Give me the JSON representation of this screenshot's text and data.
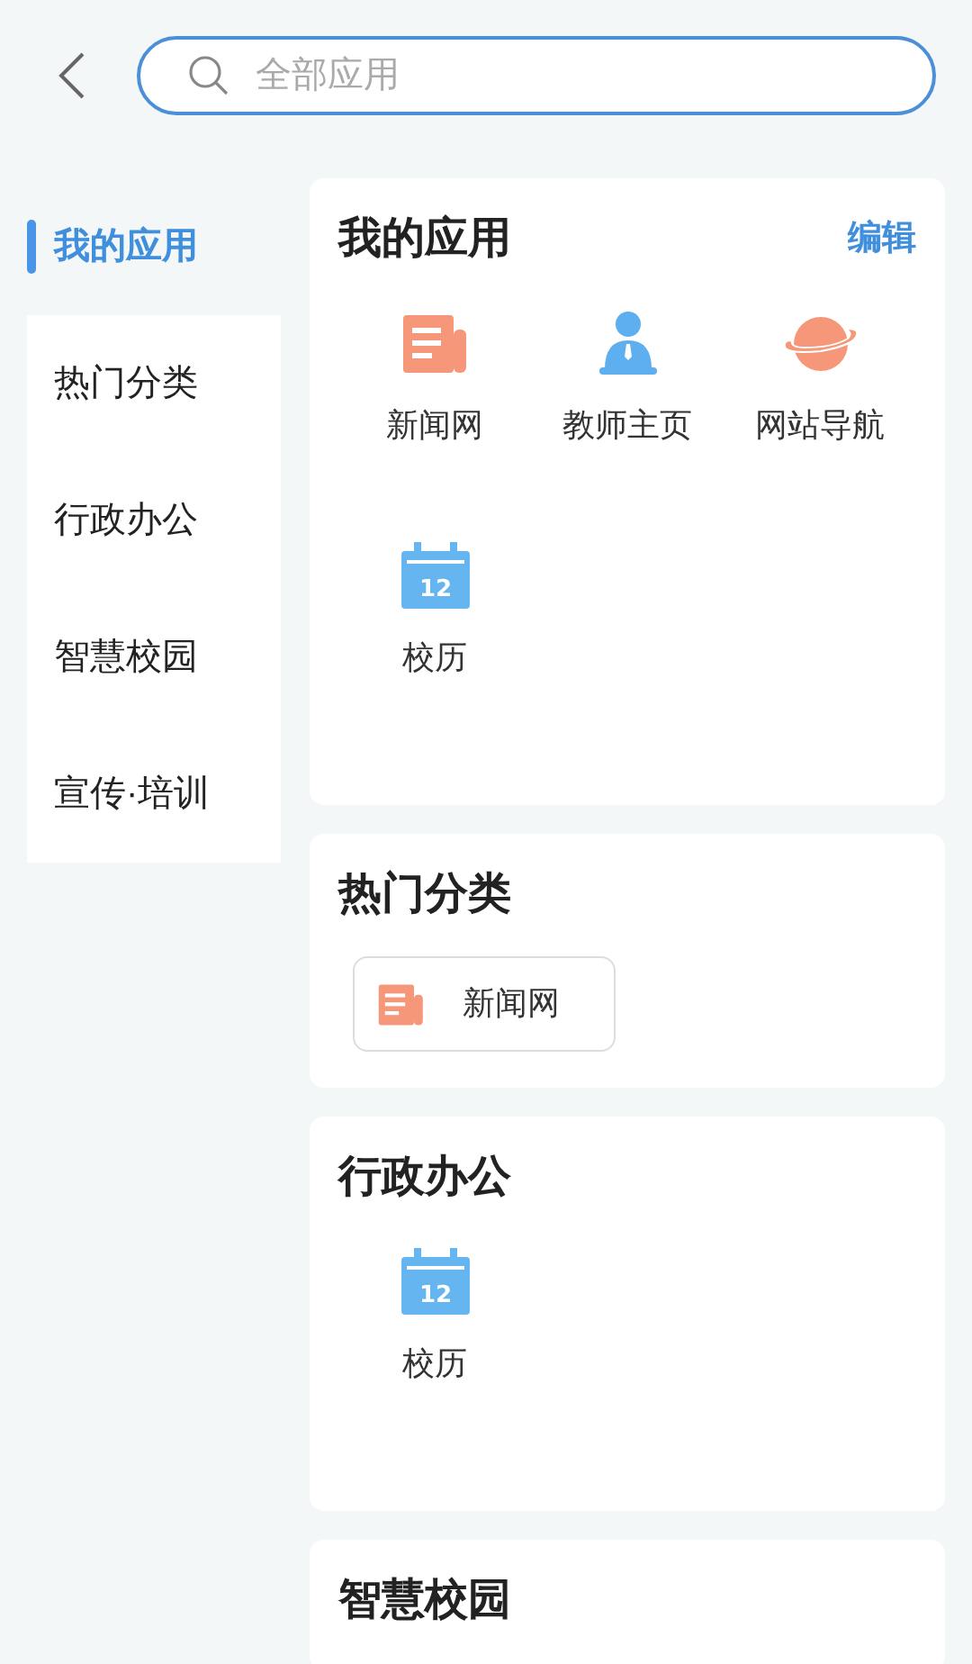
{
  "search": {
    "placeholder": "全部应用"
  },
  "sidebar": {
    "items": [
      {
        "label": "我的应用",
        "selected": true
      },
      {
        "label": "热门分类",
        "selected": false
      },
      {
        "label": "行政办公",
        "selected": false
      },
      {
        "label": "智慧校园",
        "selected": false
      },
      {
        "label": "宣传·培训",
        "selected": false
      }
    ]
  },
  "sections": [
    {
      "title": "我的应用",
      "action": "编辑",
      "kind": "grid",
      "apps": [
        {
          "label": "新闻网",
          "kind": "news"
        },
        {
          "label": "教师主页",
          "kind": "teacher"
        },
        {
          "label": "网站导航",
          "kind": "planet"
        },
        {
          "label": "校历",
          "kind": "calendar",
          "date": "12"
        }
      ]
    },
    {
      "title": "热门分类",
      "kind": "chips",
      "apps": [
        {
          "label": "新闻网",
          "kind": "news"
        }
      ]
    },
    {
      "title": "行政办公",
      "kind": "grid",
      "apps": [
        {
          "label": "校历",
          "kind": "calendar",
          "date": "12"
        }
      ]
    },
    {
      "title": "智慧校园",
      "kind": "grid"
    }
  ]
}
